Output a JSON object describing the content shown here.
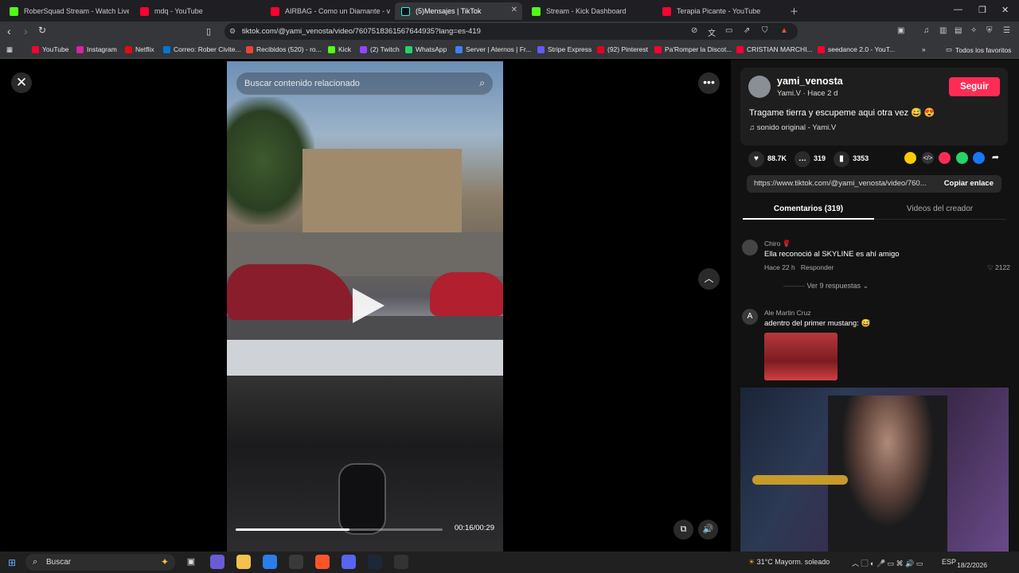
{
  "browser": {
    "tabs": [
      {
        "label": "RoberSquad Stream - Watch Live",
        "color": "#53fc18"
      },
      {
        "label": "mdq - YouTube",
        "color": "#ff0033"
      },
      {
        "label": "AIRBAG - Como un Diamante - video",
        "color": "#ff0033"
      },
      {
        "label": "(5)Mensajes | TikTok",
        "color": "#111111"
      },
      {
        "label": "Stream - Kick Dashboard",
        "color": "#53fc18"
      },
      {
        "label": "Terapia Picante - YouTube",
        "color": "#ff0033"
      }
    ],
    "url": "tiktok.com/@yami_venosta/video/7607518361567644935?lang=es-419",
    "bookmarks": [
      {
        "label": "YouTube",
        "color": "#ff0033"
      },
      {
        "label": "Instagram",
        "color": "#d6249f"
      },
      {
        "label": "Netflix",
        "color": "#e50914"
      },
      {
        "label": "Correo: Rober Civite...",
        "color": "#0078d4"
      },
      {
        "label": "Recibidos (520) - ro...",
        "color": "#ea4335"
      },
      {
        "label": "Kick",
        "color": "#53fc18"
      },
      {
        "label": "(2) Twitch",
        "color": "#9146ff"
      },
      {
        "label": "WhatsApp",
        "color": "#25d366"
      },
      {
        "label": "Server | Aternos | Fr...",
        "color": "#3b82f6"
      },
      {
        "label": "Stripe Express",
        "color": "#635bff"
      },
      {
        "label": "(92) Pinterest",
        "color": "#e60023"
      },
      {
        "label": "Pa'Romper la Discot...",
        "color": "#ff0033"
      },
      {
        "label": "CRISTIAN MARCHI...",
        "color": "#ff0033"
      },
      {
        "label": "seedance 2.0 - YouT...",
        "color": "#ff0033"
      }
    ],
    "all_bookmarks": "Todos los favoritos"
  },
  "video": {
    "search_placeholder": "Buscar contenido relacionado",
    "time": "00:16/00:29",
    "progress": 0.55
  },
  "post": {
    "username": "yami_venosta",
    "nickname": "Yami.V · Hace 2 d",
    "follow": "Seguir",
    "description": "Tragame tierra y escupeme aqui otra vez 😅 😍",
    "sound": "sonido original - Yami.V",
    "likes": "88.7K",
    "comments": "319",
    "saves": "3353",
    "link": "https://www.tiktok.com/@yami_venosta/video/760...",
    "copy": "Copiar enlace",
    "tab_comments": "Comentarios (319)",
    "tab_creator": "Videos del creador"
  },
  "comments": [
    {
      "user": "Chiro 🌹",
      "text": "Ella reconoció al SKYLINE es ahí amigo",
      "time": "Hace 22 h",
      "reply": "Responder",
      "likes": "2122",
      "replies": "Ver 9 respuestas"
    },
    {
      "user": "Ale Martin Cruz",
      "initial": "A",
      "text": "adentro del primer mustang: 😅"
    }
  ],
  "taskbar": {
    "search": "Buscar",
    "weather": "31°C  Mayorm. soleado",
    "lang": "ESP",
    "date": "18/2/2026"
  }
}
